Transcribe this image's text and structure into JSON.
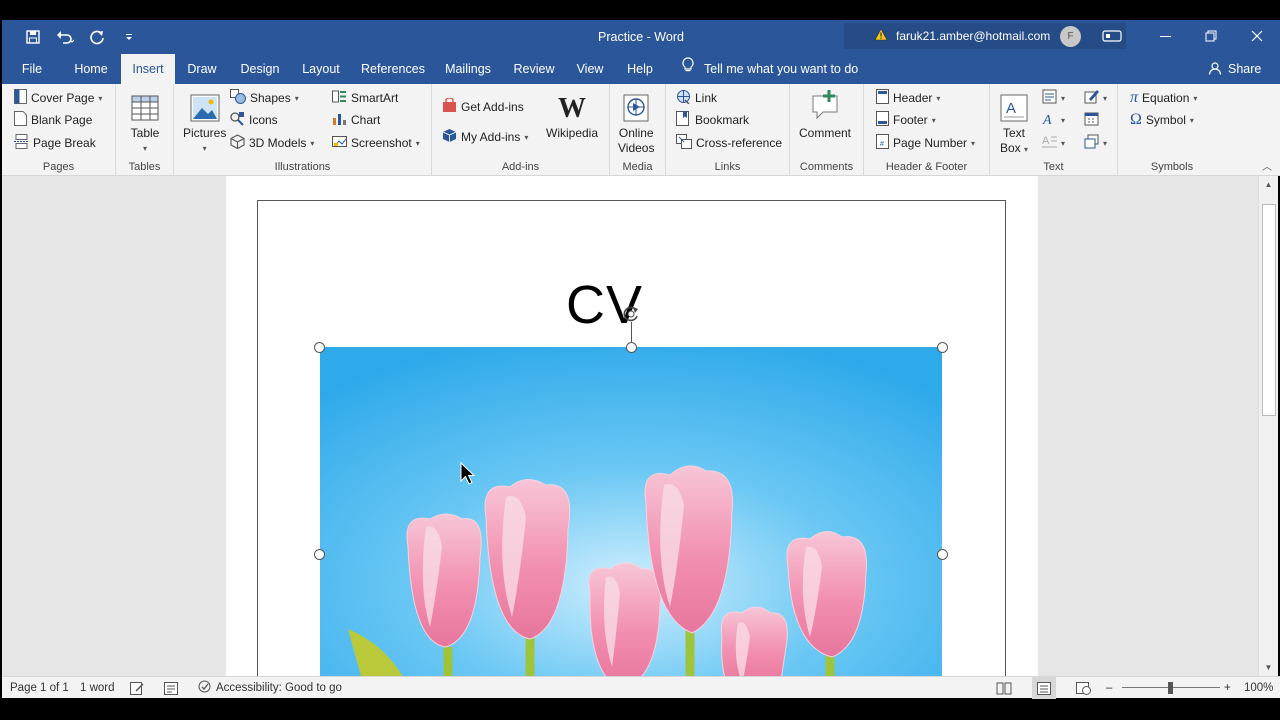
{
  "titlebar": {
    "document_title": "Practice  -  Word",
    "account_email": "faruk21.amber@hotmail.com",
    "avatar_initial": "F",
    "warning_icon": "warning-icon",
    "quick_access": [
      "save-icon",
      "undo-icon",
      "redo-icon",
      "customize-qat-icon"
    ],
    "window_controls": [
      "ribbon-display-icon",
      "minimize-icon",
      "restore-icon",
      "close-icon"
    ]
  },
  "tabs": [
    "File",
    "Home",
    "Insert",
    "Draw",
    "Design",
    "Layout",
    "References",
    "Mailings",
    "Review",
    "View",
    "Help"
  ],
  "active_tab": "Insert",
  "tell_me": "Tell me what you want to do",
  "share_label": "Share",
  "ribbon": {
    "pages": {
      "label": "Pages",
      "cover_page": "Cover Page",
      "blank_page": "Blank Page",
      "page_break": "Page Break"
    },
    "tables": {
      "label": "Tables",
      "table": "Table"
    },
    "illustrations": {
      "label": "Illustrations",
      "pictures": "Pictures",
      "shapes": "Shapes",
      "icons": "Icons",
      "models_3d": "3D Models",
      "smartart": "SmartArt",
      "chart": "Chart",
      "screenshot": "Screenshot"
    },
    "addins": {
      "label": "Add-ins",
      "get_addins": "Get Add-ins",
      "my_addins": "My Add-ins",
      "wikipedia": "Wikipedia"
    },
    "media": {
      "label": "Media",
      "online_videos_1": "Online",
      "online_videos_2": "Videos"
    },
    "links": {
      "label": "Links",
      "link": "Link",
      "bookmark": "Bookmark",
      "cross_reference": "Cross-reference"
    },
    "comments": {
      "label": "Comments",
      "comment": "Comment"
    },
    "header_footer": {
      "label": "Header & Footer",
      "header": "Header",
      "footer": "Footer",
      "page_number": "Page Number"
    },
    "text": {
      "label": "Text",
      "text_box_1": "Text",
      "text_box_2": "Box"
    },
    "symbols": {
      "label": "Symbols",
      "equation": "Equation",
      "symbol": "Symbol"
    }
  },
  "document": {
    "heading": "CV",
    "picture_subject": "pink tulips on blue background"
  },
  "status": {
    "page": "Page 1 of 1",
    "words": "1 word",
    "accessibility": "Accessibility: Good to go",
    "zoom": "100%",
    "zoom_fraction": 0.5
  },
  "colors": {
    "word_blue": "#2b579a",
    "ribbon_bg": "#f3f3f3",
    "workspace_bg": "#e6e6e6",
    "sky_blue": "#2ea9ea",
    "tulip_pink": "#f28fb0"
  }
}
